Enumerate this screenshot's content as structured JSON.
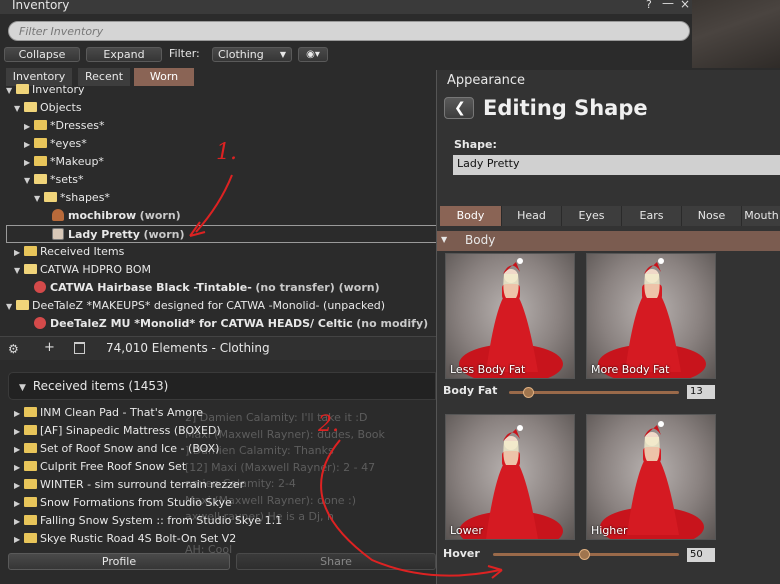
{
  "inventory": {
    "title": "Inventory",
    "help_glyph": "?",
    "minimize_glyph": "—",
    "close_glyph": "×",
    "filter_placeholder": "Filter Inventory",
    "collapse_label": "Collapse",
    "expand_label": "Expand",
    "filter_label": "Filter:",
    "filter_value": "Clothing",
    "tabs": [
      "Inventory",
      "Recent",
      "Worn"
    ],
    "tree": {
      "root": "Inventory",
      "objects": "Objects",
      "dresses": "*Dresses*",
      "eyes": "*eyes*",
      "makeup": "*Makeup*",
      "sets": "*sets*",
      "shapes": "*shapes*",
      "mochibrow": "mochibrow",
      "mochibrow_suffix": "(worn)",
      "lady_pretty": "Lady Pretty",
      "lady_pretty_suffix": "(worn)",
      "received_items": "Received Items",
      "catwa_bom": "CATWA HDPRO BOM",
      "catwa_hair": "CATWA Hairbase Black -Tintable-",
      "catwa_hair_suffix": "(no transfer) (worn)",
      "deetalez_folder": "DeeTaleZ *MAKEUPS* designed for CATWA -Monolid- (unpacked)",
      "deetalez_item": "DeeTaleZ MU *Monolid* for CATWA HEADS/ Celtic",
      "deetalez_item_suffix": "(no modify)"
    },
    "status": {
      "gear_glyph": "⚙",
      "plus_glyph": "+",
      "element_count": "74,010 Elements  -  Clothing"
    },
    "received_header": "Received items (1453)",
    "received_items": [
      "INM Clean Pad - That's Amore",
      "[AF] Sinapedic Mattress (BOXED)",
      "Set of Roof Snow and Ice - (BOX)",
      "Culprit Free Roof Snow Set",
      "WINTER -  sim surround terrain rezzer",
      "Snow Formations  from Studio Skye",
      "Falling Snow System :: from Studio Skye 1.1",
      "Skye Rustic Road 4S Bolt-On Set V2"
    ],
    "profile_label": "Profile",
    "share_label": "Share"
  },
  "background_chat": [
    "2] Damien Calamity: I'll take it :D",
    "Maxi (Maxwell Rayner): dudes, Book",
    "] Damien Calamity: Thanks",
    "[12] Maxi (Maxwell Rayner): 2 - 47",
    "amien Calamity: 2-4",
    "Maxi (Maxwell Rayner): done :)",
    "axwell rayner) He is a Dj, h",
    "",
    "AH: Cool"
  ],
  "appearance": {
    "title": "Appearance",
    "back_glyph": "❮",
    "editing_title": "Editing Shape",
    "shape_label": "Shape:",
    "shape_value": "Lady Pretty",
    "tabs": [
      "Body",
      "Head",
      "Eyes",
      "Ears",
      "Nose",
      "Mouth"
    ],
    "section": "Body",
    "body_fat": {
      "low_label": "Less Body Fat",
      "high_label": "More Body Fat",
      "slider_label": "Body Fat",
      "value": "13"
    },
    "hover": {
      "low_label": "Lower",
      "high_label": "Higher",
      "slider_label": "Hover",
      "value": "50"
    }
  },
  "annotations": {
    "one": "1.",
    "two": "2."
  },
  "colors": {
    "accent_tab": "#8a6455",
    "section_header": "#7b5c50",
    "annotation": "#dd2222"
  }
}
